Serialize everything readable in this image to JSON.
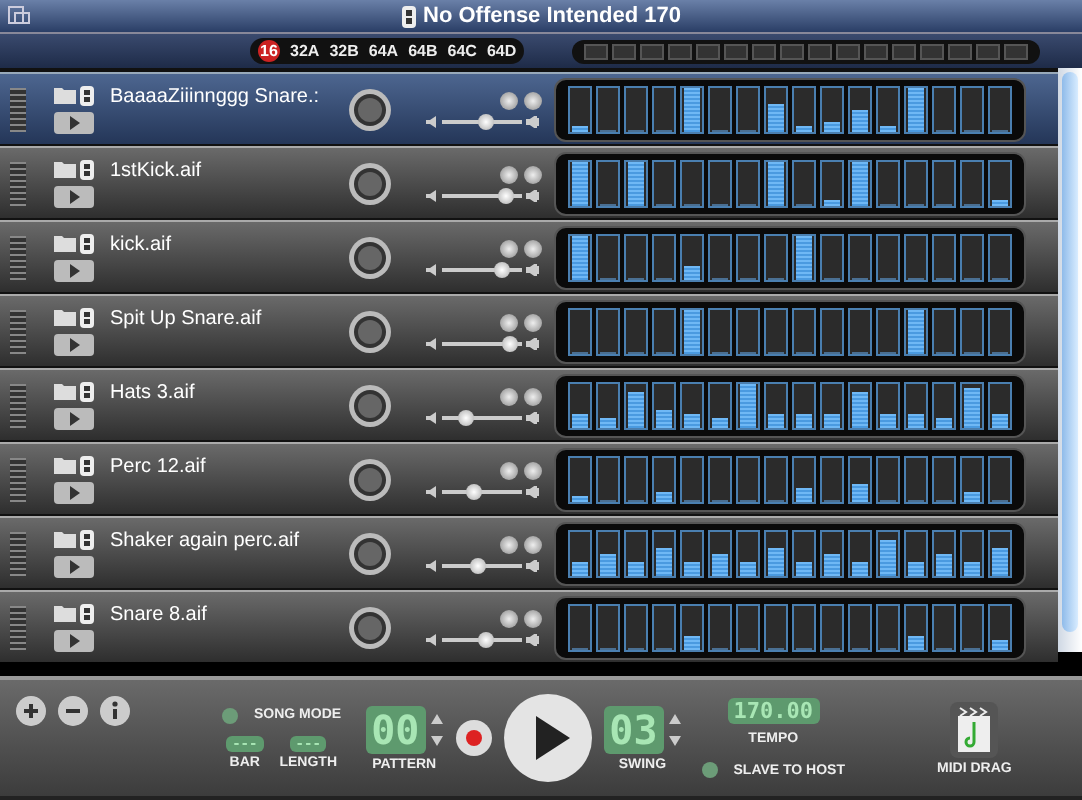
{
  "title": "No Offense Intended 170",
  "banks": [
    {
      "label": "16",
      "selected": true
    },
    {
      "label": "32A",
      "selected": false
    },
    {
      "label": "32B",
      "selected": false
    },
    {
      "label": "64A",
      "selected": false
    },
    {
      "label": "64B",
      "selected": false
    },
    {
      "label": "64C",
      "selected": false
    },
    {
      "label": "64D",
      "selected": false
    }
  ],
  "tracks": [
    {
      "name": "BaaaaZiiinnggg Snare.:",
      "selected": true,
      "volume": {
        "level": 0.55
      },
      "steps": [
        {
          "level": 0.1
        },
        {
          "level": 0
        },
        {
          "level": 0
        },
        {
          "level": 0
        },
        {
          "level": 1
        },
        {
          "level": 0
        },
        {
          "level": 0
        },
        {
          "level": 0.6
        },
        {
          "level": 0.1
        },
        {
          "level": 0.2
        },
        {
          "level": 0.5
        },
        {
          "level": 0.1
        },
        {
          "level": 1
        },
        {
          "level": 0
        },
        {
          "level": 0
        },
        {
          "level": 0
        }
      ]
    },
    {
      "name": "1stKick.aif",
      "selected": false,
      "volume": {
        "level": 0.8
      },
      "steps": [
        {
          "level": 1
        },
        {
          "level": 0
        },
        {
          "level": 1
        },
        {
          "level": 0
        },
        {
          "level": 0
        },
        {
          "level": 0
        },
        {
          "level": 0
        },
        {
          "level": 1
        },
        {
          "level": 0
        },
        {
          "level": 0.1
        },
        {
          "level": 1
        },
        {
          "level": 0
        },
        {
          "level": 0
        },
        {
          "level": 0
        },
        {
          "level": 0
        },
        {
          "level": 0.1
        }
      ]
    },
    {
      "name": "kick.aif",
      "selected": false,
      "volume": {
        "level": 0.75
      },
      "steps": [
        {
          "level": 1
        },
        {
          "level": 0
        },
        {
          "level": 0
        },
        {
          "level": 0
        },
        {
          "level": 0.3
        },
        {
          "level": 0
        },
        {
          "level": 0
        },
        {
          "level": 0
        },
        {
          "level": 1
        },
        {
          "level": 0
        },
        {
          "level": 0
        },
        {
          "level": 0
        },
        {
          "level": 0
        },
        {
          "level": 0
        },
        {
          "level": 0
        },
        {
          "level": 0
        }
      ]
    },
    {
      "name": "Spit Up Snare.aif",
      "selected": false,
      "volume": {
        "level": 0.85
      },
      "steps": [
        {
          "level": 0
        },
        {
          "level": 0
        },
        {
          "level": 0
        },
        {
          "level": 0
        },
        {
          "level": 1
        },
        {
          "level": 0
        },
        {
          "level": 0
        },
        {
          "level": 0
        },
        {
          "level": 0
        },
        {
          "level": 0
        },
        {
          "level": 0
        },
        {
          "level": 0
        },
        {
          "level": 1
        },
        {
          "level": 0
        },
        {
          "level": 0
        },
        {
          "level": 0
        }
      ]
    },
    {
      "name": "Hats 3.aif",
      "selected": false,
      "volume": {
        "level": 0.3
      },
      "steps": [
        {
          "level": 0.3
        },
        {
          "level": 0.2
        },
        {
          "level": 0.8
        },
        {
          "level": 0.4
        },
        {
          "level": 0.3
        },
        {
          "level": 0.2
        },
        {
          "level": 1
        },
        {
          "level": 0.3
        },
        {
          "level": 0.3
        },
        {
          "level": 0.3
        },
        {
          "level": 0.8
        },
        {
          "level": 0.3
        },
        {
          "level": 0.3
        },
        {
          "level": 0.2
        },
        {
          "level": 0.9
        },
        {
          "level": 0.3
        }
      ]
    },
    {
      "name": "Perc 12.aif",
      "selected": false,
      "volume": {
        "level": 0.4
      },
      "steps": [
        {
          "level": 0.1
        },
        {
          "level": 0
        },
        {
          "level": 0
        },
        {
          "level": 0.2
        },
        {
          "level": 0
        },
        {
          "level": 0
        },
        {
          "level": 0
        },
        {
          "level": 0
        },
        {
          "level": 0.3
        },
        {
          "level": 0
        },
        {
          "level": 0.4
        },
        {
          "level": 0
        },
        {
          "level": 0
        },
        {
          "level": 0
        },
        {
          "level": 0.2
        },
        {
          "level": 0
        }
      ]
    },
    {
      "name": "Shaker again perc.aif",
      "selected": false,
      "volume": {
        "level": 0.45
      },
      "steps": [
        {
          "level": 0.3
        },
        {
          "level": 0.5
        },
        {
          "level": 0.3
        },
        {
          "level": 0.6
        },
        {
          "level": 0.3
        },
        {
          "level": 0.5
        },
        {
          "level": 0.3
        },
        {
          "level": 0.6
        },
        {
          "level": 0.3
        },
        {
          "level": 0.5
        },
        {
          "level": 0.3
        },
        {
          "level": 0.8
        },
        {
          "level": 0.3
        },
        {
          "level": 0.5
        },
        {
          "level": 0.3
        },
        {
          "level": 0.6
        }
      ]
    },
    {
      "name": "Snare 8.aif",
      "selected": false,
      "volume": {
        "level": 0.55
      },
      "steps": [
        {
          "level": 0
        },
        {
          "level": 0
        },
        {
          "level": 0
        },
        {
          "level": 0
        },
        {
          "level": 0.3
        },
        {
          "level": 0
        },
        {
          "level": 0
        },
        {
          "level": 0
        },
        {
          "level": 0
        },
        {
          "level": 0
        },
        {
          "level": 0
        },
        {
          "level": 0
        },
        {
          "level": 0.3
        },
        {
          "level": 0
        },
        {
          "level": 0
        },
        {
          "level": 0.2
        }
      ]
    }
  ],
  "transport": {
    "song_mode": "SONG MODE",
    "bar": {
      "value": "---",
      "label": "BAR"
    },
    "length": {
      "value": "---",
      "label": "LENGTH"
    },
    "pattern": {
      "value": "00",
      "label": "PATTERN"
    },
    "swing": {
      "value": "03",
      "label": "SWING"
    },
    "tempo": {
      "value": "170.00",
      "label": "TEMPO"
    },
    "slave_to_host": "SLAVE TO HOST",
    "midi_drag": "MIDI DRAG"
  }
}
